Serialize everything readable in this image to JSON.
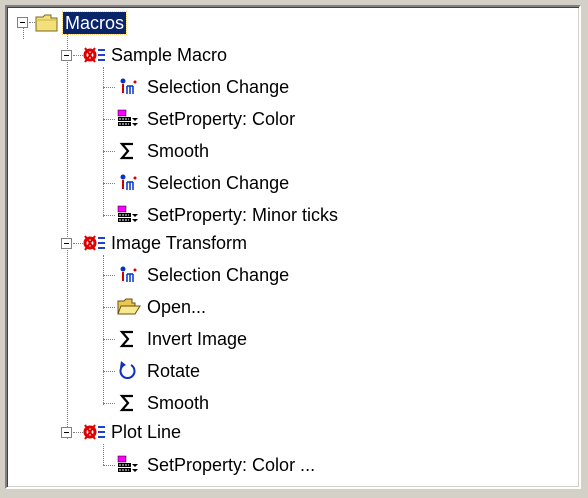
{
  "tree": {
    "root": {
      "label": "Macros",
      "icon": "folder-icon"
    },
    "macros": [
      {
        "label": "Sample Macro",
        "icon": "macro-icon",
        "steps": [
          {
            "label": "Selection Change",
            "icon": "selection-change-icon"
          },
          {
            "label": "SetProperty: Color",
            "icon": "set-property-icon"
          },
          {
            "label": "Smooth",
            "icon": "sigma-icon"
          },
          {
            "label": "Selection Change",
            "icon": "selection-change-icon"
          },
          {
            "label": "SetProperty: Minor ticks",
            "icon": "set-property-icon"
          }
        ]
      },
      {
        "label": "Image Transform",
        "icon": "macro-icon",
        "steps": [
          {
            "label": "Selection Change",
            "icon": "selection-change-icon"
          },
          {
            "label": "Open...",
            "icon": "open-folder-icon"
          },
          {
            "label": "Invert Image",
            "icon": "sigma-icon"
          },
          {
            "label": "Rotate",
            "icon": "rotate-icon"
          },
          {
            "label": "Smooth",
            "icon": "sigma-icon"
          }
        ]
      },
      {
        "label": "Plot Line",
        "icon": "macro-icon",
        "steps": [
          {
            "label": "SetProperty: Color ...",
            "icon": "set-property-icon"
          }
        ]
      }
    ]
  },
  "colors": {
    "selection_bg": "#0a246a",
    "window_bg": "#d4d0c8"
  }
}
